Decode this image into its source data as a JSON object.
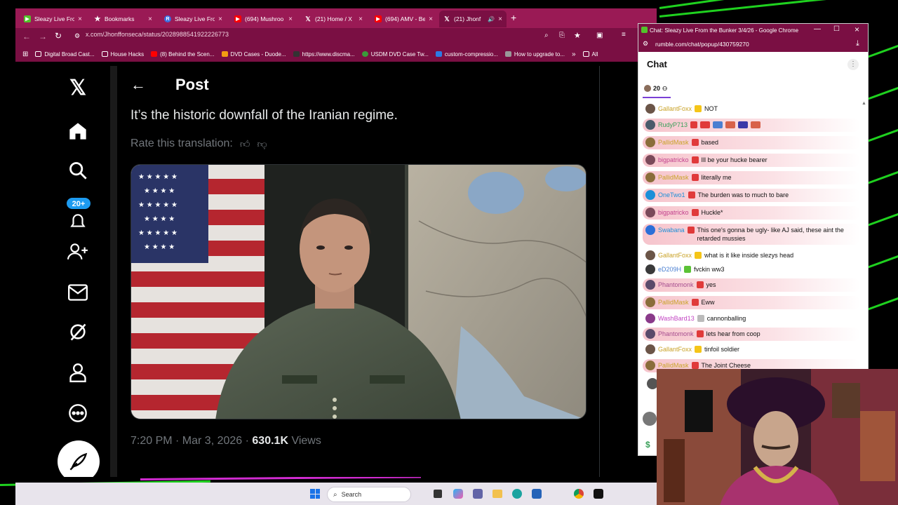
{
  "browser": {
    "tabs": [
      {
        "label": "Sleazy Live Fro",
        "color": "#53c22b"
      },
      {
        "label": "Bookmarks",
        "color": "#ffcc00"
      },
      {
        "label": "Sleazy Live Fro",
        "color": "#3b6fe0"
      },
      {
        "label": "(694) Mushroo",
        "color": "#ff0000"
      },
      {
        "label": "(21) Home / X",
        "color": "#000000"
      },
      {
        "label": "(694) AMV - Be",
        "color": "#ff0000"
      },
      {
        "label": "(21) Jhonf",
        "color": "#000000"
      }
    ],
    "url": "x.com/Jhonffonseca/status/2028988541922226773",
    "bookmarks": [
      "Digital Broad Cast...",
      "House Hacks",
      "(8) Behind the Scen...",
      "DVD Cases - Duode...",
      "https://www.discma...",
      "USDM DVD Case Tw...",
      "custom-compressio...",
      "How to upgrade to..."
    ],
    "bookmark_more": "All"
  },
  "xpage": {
    "header_title": "Post",
    "post_text": "It’s the historic downfall of the Iranian regime.",
    "rate_translation": "Rate this translation:",
    "timestamp": "7:20 PM · Mar 3, 2026 · ",
    "views_count": "630.1K",
    "views_label": " Views",
    "notification_badge": "20+"
  },
  "chat": {
    "window_title": "Chat: Sleazy Live From the Bunker 3/4/26 - Google Chrome",
    "url": "rumble.com/chat/popup/430759270",
    "header": "Chat",
    "viewer_count": "20",
    "messages": [
      {
        "user": "GallantFoxx",
        "text": "NOT",
        "user_color": "#c9a227",
        "badge": "#f5c518",
        "highlight": false
      },
      {
        "user": "RudyP713",
        "text": "",
        "user_color": "#3aa05a",
        "badge": "#e03a3a",
        "highlight": true
      },
      {
        "user": "PallidMask",
        "text": "based",
        "user_color": "#c9a227",
        "badge": "#e03a3a",
        "highlight": true
      },
      {
        "user": "bigpatricko",
        "text": "Ill be your hucke bearer",
        "user_color": "#c2418d",
        "badge": "#e03a3a",
        "highlight": true
      },
      {
        "user": "PallidMask",
        "text": "literally me",
        "user_color": "#c9a227",
        "badge": "#e03a3a",
        "highlight": true
      },
      {
        "user": "OneTwo1",
        "text": "The burden was to much to bare",
        "user_color": "#1c8fd8",
        "badge": "#e03a3a",
        "highlight": true
      },
      {
        "user": "bigpatricko",
        "text": "Huckle*",
        "user_color": "#c2418d",
        "badge": "#e03a3a",
        "highlight": true
      },
      {
        "user": "Swabana",
        "text": "This one's gonna be ugly- like AJ said, these aint the retarded mussies",
        "user_color": "#1c8fd8",
        "badge": "#e03a3a",
        "highlight": true
      },
      {
        "user": "GallantFoxx",
        "text": "what is it like inside slezys head",
        "user_color": "#c9a227",
        "badge": "#f5c518",
        "highlight": false
      },
      {
        "user": "eD209H",
        "text": "fvckin ww3",
        "user_color": "#4a7fd1",
        "badge": "#5bc236",
        "highlight": false
      },
      {
        "user": "Phantomonk",
        "text": "yes",
        "user_color": "#a64d8f",
        "badge": "#e03a3a",
        "highlight": true
      },
      {
        "user": "PallidMask",
        "text": "Eww",
        "user_color": "#c9a227",
        "badge": "#e03a3a",
        "highlight": true
      },
      {
        "user": "WashBard13",
        "text": "cannonballing",
        "user_color": "#c243c2",
        "badge": "#bbbbbb",
        "highlight": false
      },
      {
        "user": "Phantomonk",
        "text": "lets hear from coop",
        "user_color": "#a64d8f",
        "badge": "#e03a3a",
        "highlight": true
      },
      {
        "user": "GallantFoxx",
        "text": "tinfoil soldier",
        "user_color": "#c9a227",
        "badge": "#f5c518",
        "highlight": false
      },
      {
        "user": "PallidMask",
        "text": "The Joint Cheese",
        "user_color": "#c9a227",
        "badge": "#e03a3a",
        "highlight": true
      }
    ]
  },
  "taskbar": {
    "search_placeholder": "Search"
  },
  "colors": {
    "tabbar": "#9a1a55",
    "addressbar": "#7a0f43",
    "x_badge": "#1d9bf0"
  }
}
